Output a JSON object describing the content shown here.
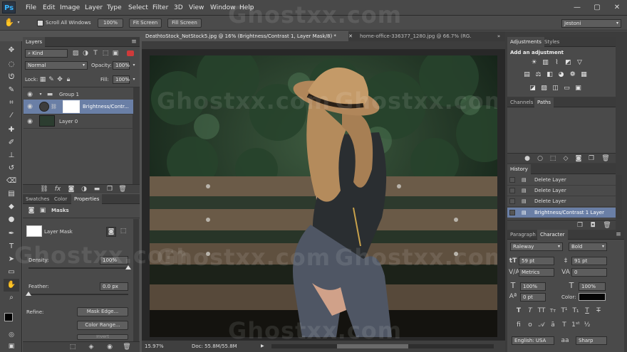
{
  "app": {
    "logo": "Ps"
  },
  "menu": [
    "File",
    "Edit",
    "Image",
    "Layer",
    "Type",
    "Select",
    "Filter",
    "3D",
    "View",
    "Window",
    "Help"
  ],
  "window_controls": {
    "min": "—",
    "max": "▢",
    "close": "✕"
  },
  "options": {
    "scroll_all_windows": "Scroll All Windows",
    "zoom_100": "100%",
    "fit_screen": "Fit Screen",
    "fill_screen": "Fill Screen",
    "workspace": "Jestoni"
  },
  "doc_tabs": [
    {
      "label": "DeathtoStock_NotStock5.jpg @ 16% (Brightness/Contrast 1, Layer Mask/8) *",
      "close": "✕"
    },
    {
      "label": "home-office-336377_1280.jpg @ 66.7% (RG...",
      "close": ""
    }
  ],
  "layers_panel": {
    "tab": "Layers",
    "kind": "Kind",
    "blend_mode": "Normal",
    "opacity_label": "Opacity:",
    "opacity_value": "100%",
    "lock_label": "Lock:",
    "fill_label": "Fill:",
    "fill_value": "100%",
    "layers": [
      {
        "name": "Group 1",
        "type": "group"
      },
      {
        "name": "Brightness/Contr...",
        "type": "adjustment",
        "selected": true
      },
      {
        "name": "Layer 0",
        "type": "image"
      }
    ],
    "footer_icons": [
      "link-icon",
      "fx-icon",
      "mask-icon",
      "adjustment-icon",
      "folder-icon",
      "new-layer-icon",
      "trash-icon"
    ]
  },
  "properties_panel": {
    "tabs": [
      "Swatches",
      "Color",
      "Properties"
    ],
    "title": "Masks",
    "mask_name": "Layer Mask",
    "density_label": "Density:",
    "density_value": "100%",
    "density_level": 1.0,
    "feather_label": "Feather:",
    "feather_value": "0.0 px",
    "feather_level": 0.0,
    "refine_label": "Refine:",
    "mask_edge_button": "Mask Edge...",
    "color_range_button": "Color Range...",
    "invert_button": "Invert"
  },
  "adjustments_panel": {
    "tabs": [
      "Adjustments",
      "Styles"
    ],
    "title": "Add an adjustment"
  },
  "channels_panel": {
    "tabs": [
      "Channels",
      "Paths"
    ]
  },
  "history_panel": {
    "tab": "History",
    "items": [
      "Delete Layer",
      "Delete Layer",
      "Delete Layer",
      "Brightness/Contrast 1 Layer"
    ]
  },
  "character_panel": {
    "tabs": [
      "Paragraph",
      "Character"
    ],
    "font_family": "Raleway",
    "font_style": "Bold",
    "font_size": "59 pt",
    "leading": "91 pt",
    "kerning": "Metrics",
    "tracking": "0",
    "vscale": "100%",
    "hscale": "100%",
    "baseline": "0 pt",
    "color_label": "Color:",
    "language": "English: USA",
    "antialias": "Sharp"
  },
  "status": {
    "zoom": "15.97%",
    "doc": "Doc: 55.8M/55.8M"
  },
  "watermarks": [
    "Ghostxx.com",
    "Ghostxx.com",
    "Ghostxx.com",
    "Ghostxx.com",
    "Ghostxx.com",
    "Ghostxx.com",
    "Ghostxx.com"
  ],
  "colors": {
    "accent_selected": "#6a7fa6",
    "ps_blue": "#38b4ff"
  }
}
